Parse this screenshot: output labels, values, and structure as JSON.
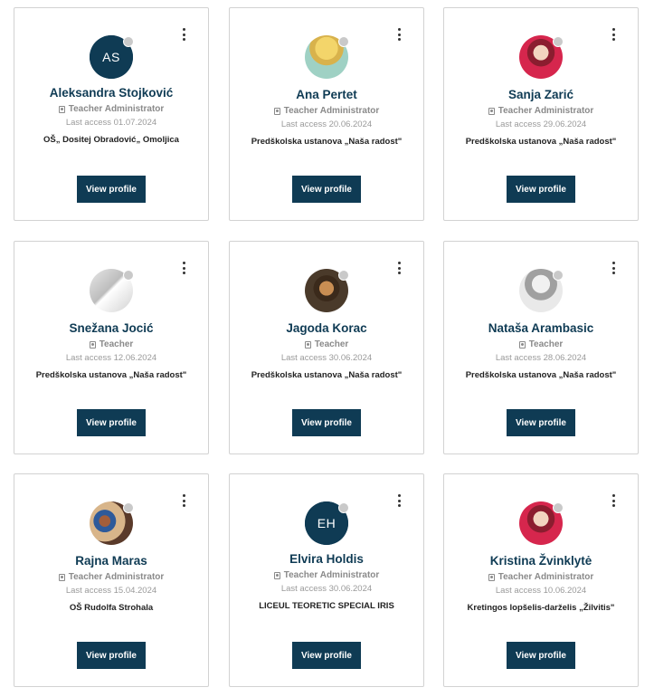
{
  "cards": [
    {
      "name": "Aleksandra  Stojković",
      "role": "Teacher Administrator",
      "access": "Last access 01.07.2024",
      "school": "OŠ„ Dositej Obradović„ Omoljica",
      "initials": "AS",
      "view_label": "View profile"
    },
    {
      "name": "Ana Pertet",
      "role": "Teacher Administrator",
      "access": "Last access 20.06.2024",
      "school": "Predškolska ustanova „Naša radost\"",
      "initials": "",
      "view_label": "View profile"
    },
    {
      "name": "Sanja Zarić",
      "role": "Teacher Administrator",
      "access": "Last access 29.06.2024",
      "school": "Predškolska ustanova „Naša radost\"",
      "initials": "",
      "view_label": "View profile"
    },
    {
      "name": "Snežana Jocić",
      "role": "Teacher",
      "access": "Last access 12.06.2024",
      "school": "Predškolska ustanova „Naša radost\"",
      "initials": "",
      "view_label": "View profile"
    },
    {
      "name": "Jagoda Korac",
      "role": "Teacher",
      "access": "Last access 30.06.2024",
      "school": "Predškolska ustanova „Naša radost\"",
      "initials": "",
      "view_label": "View profile"
    },
    {
      "name": "Nataša Arambasic",
      "role": "Teacher",
      "access": "Last access 28.06.2024",
      "school": "Predškolska ustanova „Naša radost\"",
      "initials": "",
      "view_label": "View profile"
    },
    {
      "name": "Rajna Maras",
      "role": "Teacher Administrator",
      "access": "Last access 15.04.2024",
      "school": "OŠ Rudolfa  Strohala",
      "initials": "",
      "view_label": "View profile"
    },
    {
      "name": "Elvira Holdis",
      "role": "Teacher Administrator",
      "access": "Last access 30.06.2024",
      "school": "LICEUL TEORETIC SPECIAL IRIS",
      "initials": "EH",
      "view_label": "View profile"
    },
    {
      "name": "Kristina Žvinklytė",
      "role": "Teacher Administrator",
      "access": "Last access 10.06.2024",
      "school": "Kretingos lopšelis-darželis „Žilvitis\"",
      "initials": "",
      "view_label": "View profile"
    }
  ],
  "colors": {
    "accent": "#0f3b54",
    "status_offline": "#c9c9c9",
    "muted_text": "#8a8a8a"
  },
  "icons": {
    "menu": "kebab-menu-icon",
    "role": "id-badge-icon",
    "status": "status-dot-icon"
  }
}
